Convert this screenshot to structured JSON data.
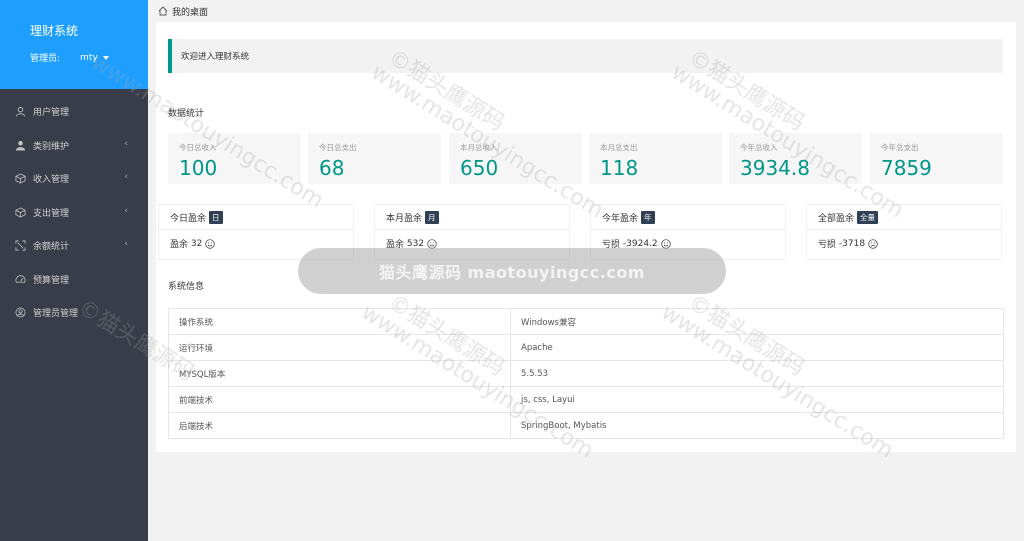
{
  "sidebar": {
    "title": "理财系统",
    "admin_label": "管理员:",
    "admin_name": "mty",
    "items": [
      {
        "label": "用户管理",
        "icon": "user-icon",
        "arrow": false
      },
      {
        "label": "类别维护",
        "icon": "person-solid-icon",
        "arrow": true
      },
      {
        "label": "收入管理",
        "icon": "box-icon",
        "arrow": true
      },
      {
        "label": "支出管理",
        "icon": "box-icon",
        "arrow": true
      },
      {
        "label": "余额统计",
        "icon": "expand-icon",
        "arrow": true
      },
      {
        "label": "预算管理",
        "icon": "gauge-icon",
        "arrow": false
      },
      {
        "label": "管理员管理",
        "icon": "user-circle-icon",
        "arrow": false
      }
    ]
  },
  "breadcrumb": {
    "home": "我的桌面"
  },
  "welcome": "欢迎进入理财系统",
  "stats_title": "数据统计",
  "stats": [
    {
      "label": "今日总收入",
      "value": "100"
    },
    {
      "label": "今日总支出",
      "value": "68"
    },
    {
      "label": "本月总收入",
      "value": "650"
    },
    {
      "label": "本月总支出",
      "value": "118"
    },
    {
      "label": "今年总收入",
      "value": "3934.8"
    },
    {
      "label": "今年总支出",
      "value": "7859"
    }
  ],
  "profits": [
    {
      "title": "今日盈余",
      "badge": "日",
      "status": "盈余",
      "value": "32",
      "mood": "happy"
    },
    {
      "title": "本月盈余",
      "badge": "月",
      "status": "盈余",
      "value": "532",
      "mood": "happy"
    },
    {
      "title": "今年盈余",
      "badge": "年",
      "status": "亏损",
      "value": "-3924.2",
      "mood": "happy"
    },
    {
      "title": "全部盈余",
      "badge": "全量",
      "status": "亏损",
      "value": "-3718",
      "mood": "sad"
    }
  ],
  "sys_title": "系统信息",
  "sys_info": [
    {
      "key": "操作系统",
      "value": "Windows兼容"
    },
    {
      "key": "运行环境",
      "value": "Apache"
    },
    {
      "key": "MYSQL版本",
      "value": "5.5.53"
    },
    {
      "key": "前端技术",
      "value": "js, css, Layui"
    },
    {
      "key": "后端技术",
      "value": "SpringBoot, Mybatis"
    }
  ],
  "watermark": {
    "banner": "猫头鹰源码 maotouyingcc.com",
    "text": "©猫头鹰源码",
    "url": "www.maotouyingcc.com"
  }
}
